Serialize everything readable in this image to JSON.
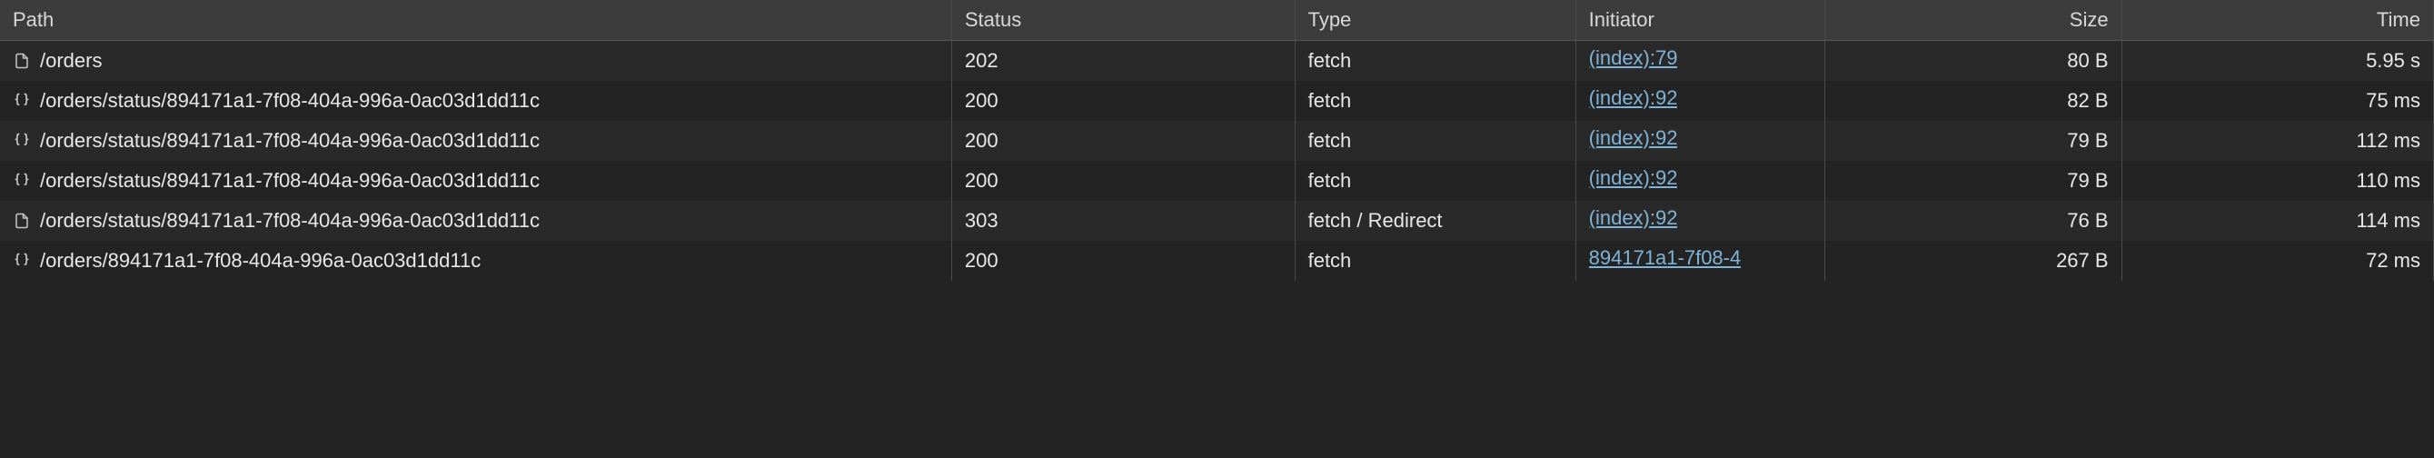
{
  "columns": {
    "path": "Path",
    "status": "Status",
    "type": "Type",
    "initiator": "Initiator",
    "size": "Size",
    "time": "Time"
  },
  "rows": [
    {
      "icon": "document-icon",
      "path": "/orders",
      "status": "202",
      "type": "fetch",
      "initiator": "(index):79",
      "size": "80 B",
      "time": "5.95 s"
    },
    {
      "icon": "json-braces-icon",
      "path": "/orders/status/894171a1-7f08-404a-996a-0ac03d1dd11c",
      "status": "200",
      "type": "fetch",
      "initiator": "(index):92",
      "size": "82 B",
      "time": "75 ms"
    },
    {
      "icon": "json-braces-icon",
      "path": "/orders/status/894171a1-7f08-404a-996a-0ac03d1dd11c",
      "status": "200",
      "type": "fetch",
      "initiator": "(index):92",
      "size": "79 B",
      "time": "112 ms"
    },
    {
      "icon": "json-braces-icon",
      "path": "/orders/status/894171a1-7f08-404a-996a-0ac03d1dd11c",
      "status": "200",
      "type": "fetch",
      "initiator": "(index):92",
      "size": "79 B",
      "time": "110 ms"
    },
    {
      "icon": "document-icon",
      "path": "/orders/status/894171a1-7f08-404a-996a-0ac03d1dd11c",
      "status": "303",
      "type": "fetch / Redirect",
      "initiator": "(index):92",
      "size": "76 B",
      "time": "114 ms"
    },
    {
      "icon": "json-braces-icon",
      "path": "/orders/894171a1-7f08-404a-996a-0ac03d1dd11c",
      "status": "200",
      "type": "fetch",
      "initiator": "894171a1-7f08-4",
      "size": "267 B",
      "time": "72 ms"
    }
  ]
}
